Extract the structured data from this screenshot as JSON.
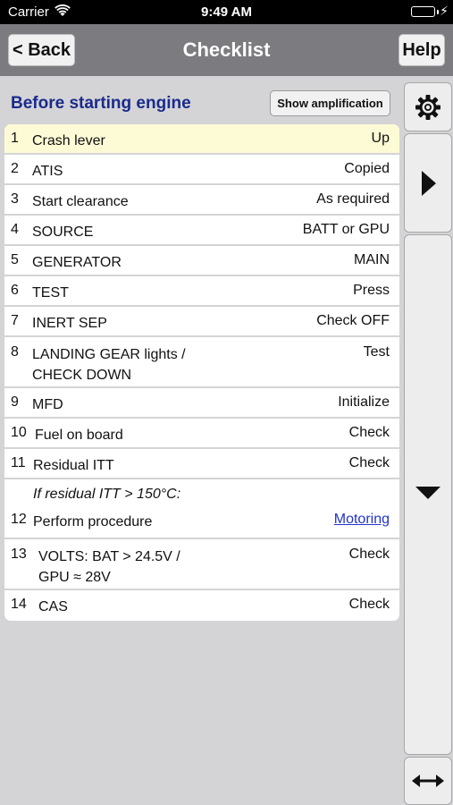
{
  "status_bar": {
    "carrier": "Carrier",
    "time": "9:49 AM",
    "battery_level": 1.0,
    "colors": {
      "battery": "#4cd964"
    }
  },
  "nav": {
    "back_label": "< Back",
    "title": "Checklist",
    "help_label": "Help"
  },
  "section": {
    "title": "Before starting engine",
    "amplification_label": "Show amplification"
  },
  "checklist": [
    {
      "num": "1",
      "item": "Crash lever",
      "value": "Up",
      "highlighted": true
    },
    {
      "num": "2",
      "item": "ATIS",
      "value": "Copied"
    },
    {
      "num": "3",
      "item": "Start clearance",
      "value": "As required"
    },
    {
      "num": "4",
      "item": "SOURCE",
      "value": "BATT or GPU"
    },
    {
      "num": "5",
      "item": "GENERATOR",
      "value": "MAIN"
    },
    {
      "num": "6",
      "item": "TEST",
      "value": "Press"
    },
    {
      "num": "7",
      "item": "INERT SEP",
      "value": "Check OFF"
    },
    {
      "num": "8",
      "item": "LANDING GEAR lights /\nCHECK DOWN",
      "value": "Test"
    },
    {
      "num": "9",
      "item": "MFD",
      "value": "Initialize"
    },
    {
      "num": "10",
      "item": "Fuel on board",
      "value": "Check"
    },
    {
      "num": "11",
      "item": "Residual ITT",
      "value": "Check"
    },
    {
      "num": "12",
      "condition": "If residual ITT > 150°C:",
      "item": "Perform procedure",
      "value": "Motoring",
      "value_is_link": true
    },
    {
      "num": "13",
      "item": "VOLTS: BAT > 24.5V /\nGPU ≈ 28V",
      "value": "Check"
    },
    {
      "num": "14",
      "item": "CAS",
      "value": "Check"
    }
  ],
  "sidebar": {
    "icons": [
      "gear-icon",
      "play-icon",
      "triangle-down-icon",
      "double-arrow-icon"
    ]
  },
  "colors": {
    "title": "#1a2a8c",
    "highlight": "#fdfbd5",
    "link": "#2233cc",
    "nav_bar": "#7b7b80",
    "background": "#d4d4d6"
  }
}
